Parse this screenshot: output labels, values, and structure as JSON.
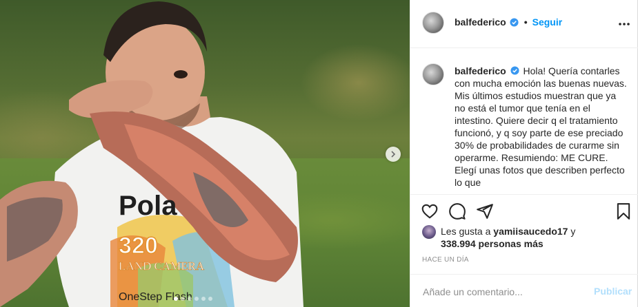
{
  "post": {
    "username": "balfederico",
    "follow_label": "Seguir",
    "separator": "•"
  },
  "caption": {
    "username": "balfederico",
    "text": "Hola! Quería contarles con mucha emoción las buenas nuevas. Mis últimos estudios muestran que ya no está el tumor que tenía en el intestino. Quiere decir q el tratamiento funcionó, y q soy parte de ese preciado 30% de probabilidades de curarme sin operarme. Resumiendo: ME CURE. Elegí unas fotos que describen perfecto lo que"
  },
  "likes": {
    "prefix": "Les gusta a",
    "user": "yamiisaucedo17",
    "conjunction": "y",
    "others": "338.994 personas más"
  },
  "timestamp": "HACE UN DÍA",
  "comment_box": {
    "placeholder": "Añade un comentario...",
    "publish_label": "Publicar"
  },
  "carousel": {
    "total_slides": 6,
    "active_index": 0
  },
  "photo": {
    "shirt_text_top": "Pola",
    "shirt_text_number": "320",
    "shirt_text_land": "LAND CAMERA",
    "shirt_text_bottom": "OneStep Flash"
  },
  "colors": {
    "link_blue": "#0095f6",
    "publish_disabled": "#b2dffc",
    "verified_blue": "#3897f0"
  }
}
